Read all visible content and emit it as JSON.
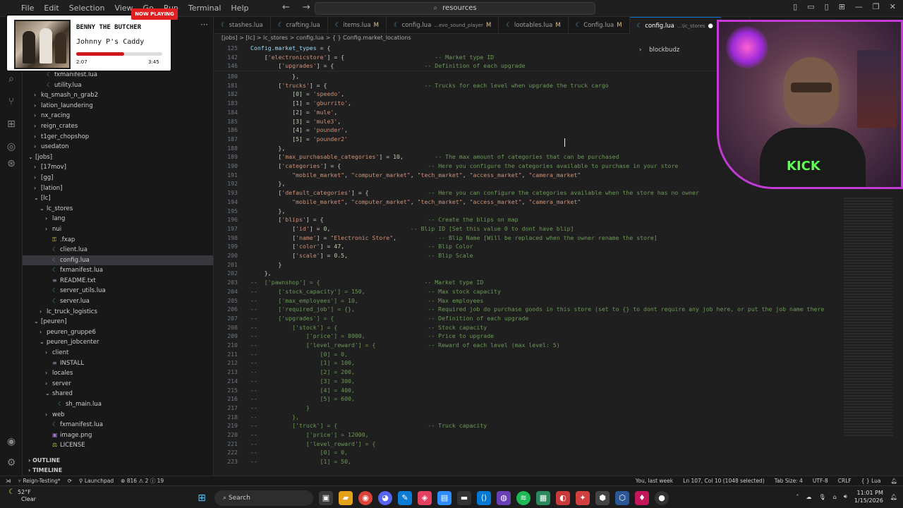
{
  "titlebar": {
    "menus": [
      "File",
      "Edit",
      "Selection",
      "View",
      "Go",
      "Run",
      "Terminal",
      "Help"
    ],
    "search_text": "resources"
  },
  "now_playing": {
    "badge": "NOW PLAYING",
    "artist": "BENNY THE BUTCHER",
    "song": "Johnny P's Caddy",
    "elapsed": "2:07",
    "duration": "3:45",
    "progress": 0.56
  },
  "explorer": {
    "rows": [
      {
        "label": "fxmanifest.lua",
        "depth": 2,
        "kind": "file",
        "icon": "lua",
        "badge": ""
      },
      {
        "label": "utility.lua",
        "depth": 2,
        "kind": "file",
        "icon": "lua",
        "badge": ""
      },
      {
        "label": "kq_smash_n_grab2",
        "depth": 1,
        "kind": "folder",
        "icon": "",
        "badge": ""
      },
      {
        "label": "lation_laundering",
        "depth": 1,
        "kind": "folder",
        "icon": "",
        "badge": ""
      },
      {
        "label": "nx_racing",
        "depth": 1,
        "kind": "folder",
        "icon": "",
        "badge": ""
      },
      {
        "label": "reign_crates",
        "depth": 1,
        "kind": "folder",
        "icon": "",
        "badge": ""
      },
      {
        "label": "t1ger_chopshop",
        "depth": 1,
        "kind": "folder",
        "icon": "",
        "badge": ""
      },
      {
        "label": "usedaton",
        "depth": 1,
        "kind": "folder",
        "icon": "",
        "badge": ""
      },
      {
        "label": "[jobs]",
        "depth": 0,
        "kind": "open",
        "icon": "",
        "badge": ""
      },
      {
        "label": "[17mov]",
        "depth": 1,
        "kind": "folder",
        "icon": "",
        "badge": ""
      },
      {
        "label": "[gg]",
        "depth": 1,
        "kind": "folder",
        "icon": "",
        "badge": ""
      },
      {
        "label": "[lation]",
        "depth": 1,
        "kind": "folder",
        "icon": "",
        "badge": ""
      },
      {
        "label": "[lc]",
        "depth": 1,
        "kind": "open",
        "icon": "",
        "badge": ""
      },
      {
        "label": "lc_stores",
        "depth": 2,
        "kind": "open",
        "icon": "",
        "badge": ""
      },
      {
        "label": "lang",
        "depth": 3,
        "kind": "folder",
        "icon": "",
        "badge": ""
      },
      {
        "label": "nui",
        "depth": 3,
        "kind": "folder",
        "icon": "",
        "badge": ""
      },
      {
        "label": ".fxap",
        "depth": 3,
        "kind": "file",
        "icon": "lock",
        "badge": ""
      },
      {
        "label": "client.lua",
        "depth": 3,
        "kind": "file",
        "icon": "lua",
        "badge": ""
      },
      {
        "label": "config.lua",
        "depth": 3,
        "kind": "file",
        "icon": "lua",
        "badge": "",
        "selected": true
      },
      {
        "label": "fxmanifest.lua",
        "depth": 3,
        "kind": "file",
        "icon": "lua",
        "badge": ""
      },
      {
        "label": "README.txt",
        "depth": 3,
        "kind": "file",
        "icon": "txt",
        "badge": ""
      },
      {
        "label": "server_utils.lua",
        "depth": 3,
        "kind": "file",
        "icon": "lua",
        "badge": ""
      },
      {
        "label": "server.lua",
        "depth": 3,
        "kind": "file",
        "icon": "lua",
        "badge": ""
      },
      {
        "label": "lc_truck_logistics",
        "depth": 2,
        "kind": "folder",
        "icon": "",
        "badge": ""
      },
      {
        "label": "[peuren]",
        "depth": 1,
        "kind": "open",
        "icon": "",
        "badge": ""
      },
      {
        "label": "peuren_gruppe6",
        "depth": 2,
        "kind": "folder",
        "icon": "",
        "badge": ""
      },
      {
        "label": "peuren_jobcenter",
        "depth": 2,
        "kind": "open",
        "icon": "",
        "badge": ""
      },
      {
        "label": "client",
        "depth": 3,
        "kind": "folder",
        "icon": "",
        "badge": ""
      },
      {
        "label": "INSTALL",
        "depth": 3,
        "kind": "file",
        "icon": "txt",
        "badge": ""
      },
      {
        "label": "locales",
        "depth": 3,
        "kind": "folder",
        "icon": "",
        "badge": ""
      },
      {
        "label": "server",
        "depth": 3,
        "kind": "folder",
        "icon": "",
        "badge": ""
      },
      {
        "label": "shared",
        "depth": 3,
        "kind": "open",
        "icon": "",
        "badge": ""
      },
      {
        "label": "sh_main.lua",
        "depth": 4,
        "kind": "file",
        "icon": "lua",
        "badge": ""
      },
      {
        "label": "web",
        "depth": 3,
        "kind": "folder",
        "icon": "",
        "badge": ""
      },
      {
        "label": "fxmanifest.lua",
        "depth": 3,
        "kind": "file",
        "icon": "lua",
        "badge": ""
      },
      {
        "label": "image.png",
        "depth": 3,
        "kind": "file",
        "icon": "img",
        "badge": ""
      },
      {
        "label": "LICENSE",
        "depth": 3,
        "kind": "file",
        "icon": "lic",
        "badge": ""
      }
    ],
    "outline_label": "OUTLINE",
    "timeline_label": "TIMELINE"
  },
  "tabs": [
    {
      "label": "stashes.lua",
      "mod": "",
      "active": false
    },
    {
      "label": "crafting.lua",
      "mod": "",
      "active": false
    },
    {
      "label": "items.lua",
      "mod": "M",
      "active": false
    },
    {
      "label": "config.lua",
      "suffix": "...evo_sound_player",
      "mod": "M",
      "active": false
    },
    {
      "label": "lootables.lua",
      "mod": "M",
      "active": false
    },
    {
      "label": "Config.lua",
      "mod": "M",
      "active": false
    },
    {
      "label": "config.lua",
      "suffix": "...\\lc_stores",
      "mod": "●",
      "active": true
    },
    {
      "label": "pr",
      "mod": "",
      "active": false
    }
  ],
  "breadcrumb": "[jobs] > [lc] > lc_stores > config.lua > { } Config.market_locations",
  "find_widget": "blockbudz",
  "sticky": [
    {
      "n": "125",
      "t": "Config.market_types = {"
    },
    {
      "n": "142",
      "t": "    ['electronicstore'] = {                          -- Market type ID"
    },
    {
      "n": "146",
      "t": "        ['upgrades'] = {                          -- Definition of each upgrade"
    }
  ],
  "code": [
    {
      "n": "180",
      "t": "            },"
    },
    {
      "n": "181",
      "t": "        ['trucks'] = {                            -- Trucks for each level when upgrade the truck cargo"
    },
    {
      "n": "182",
      "t": "            [0] = 'speedo',"
    },
    {
      "n": "183",
      "t": "            [1] = 'gburrito',"
    },
    {
      "n": "184",
      "t": "            [2] = 'mule',"
    },
    {
      "n": "185",
      "t": "            [3] = 'mule3',"
    },
    {
      "n": "186",
      "t": "            [4] = 'pounder',"
    },
    {
      "n": "187",
      "t": "            [5] = 'pounder2'"
    },
    {
      "n": "188",
      "t": "        },"
    },
    {
      "n": "189",
      "t": "        ['max_purchasable_categories'] = 10,         -- The max amount of categories that can be purchased"
    },
    {
      "n": "190",
      "t": "        ['categories'] = {                         -- Here you configure the categories available to purchase in your store"
    },
    {
      "n": "191",
      "t": "            \"mobile_market\", \"computer_market\", \"tech_market\", \"access_market\", \"camera_market\""
    },
    {
      "n": "192",
      "t": "        },"
    },
    {
      "n": "193",
      "t": "        ['default_categories'] = {                 -- Here you can configure the categories available when the store has no owner"
    },
    {
      "n": "194",
      "t": "            \"mobile_market\", \"computer_market\", \"tech_market\", \"access_market\", \"camera_market\""
    },
    {
      "n": "195",
      "t": "        },"
    },
    {
      "n": "196",
      "t": "        ['blips'] = {                              -- Create the blips on map"
    },
    {
      "n": "197",
      "t": "            ['id'] = 0,                       -- Blip ID [Set this value 0 to dont have blip]"
    },
    {
      "n": "198",
      "t": "            ['name'] = \"Electronic Store\",            -- Blip Name [Will be replaced when the owner rename the store]"
    },
    {
      "n": "199",
      "t": "            ['color'] = 47,                        -- Blip Color"
    },
    {
      "n": "200",
      "t": "            ['scale'] = 0.5,                       -- Blip Scale"
    },
    {
      "n": "201",
      "t": "        }"
    },
    {
      "n": "202",
      "t": "    },"
    },
    {
      "n": "203",
      "t": "--  ['pawnshop'] = {                              -- Market type ID"
    },
    {
      "n": "204",
      "t": "--      ['stock_capacity'] = 150,                  -- Max stock capacity"
    },
    {
      "n": "205",
      "t": "--      ['max_employees'] = 10,                    -- Max employees"
    },
    {
      "n": "206",
      "t": "--      ['required_job'] = {},                     -- Required job do purchase goods in this store (set to {} to dont require any job here, or put the job name there"
    },
    {
      "n": "207",
      "t": "--      ['upgrades'] = {                           -- Definition of each upgrade"
    },
    {
      "n": "208",
      "t": "--          ['stock'] = {                          -- Stock capacity"
    },
    {
      "n": "209",
      "t": "--              ['price'] = 8000,                  -- Price to upgrade"
    },
    {
      "n": "210",
      "t": "--              ['level_reward'] = {               -- Reward of each level (max level: 5)"
    },
    {
      "n": "211",
      "t": "--                  [0] = 0,"
    },
    {
      "n": "212",
      "t": "--                  [1] = 100,"
    },
    {
      "n": "213",
      "t": "--                  [2] = 200,"
    },
    {
      "n": "214",
      "t": "--                  [3] = 300,"
    },
    {
      "n": "215",
      "t": "--                  [4] = 400,"
    },
    {
      "n": "216",
      "t": "--                  [5] = 600,"
    },
    {
      "n": "217",
      "t": "--              }"
    },
    {
      "n": "218",
      "t": "--          },"
    },
    {
      "n": "219",
      "t": "--          ['truck'] = {                          -- Truck capacity"
    },
    {
      "n": "220",
      "t": "--              ['price'] = 12000,"
    },
    {
      "n": "221",
      "t": "--              ['level_reward'] = {"
    },
    {
      "n": "222",
      "t": "--                  [0] = 0,"
    },
    {
      "n": "223",
      "t": "--                  [1] = 50,"
    }
  ],
  "webcam": {
    "shirt_text": "KICK"
  },
  "statusbar": {
    "branch": "Reign-Testing*",
    "launchpad": "Launchpad",
    "problems": "⊗ 816 ⚠ 2 ⓘ 19",
    "blame": "You, last week",
    "position": "Ln 107, Col 10 (1048 selected)",
    "tabsize": "Tab Size: 4",
    "encoding": "UTF-8",
    "eol": "CRLF",
    "language": "Lua"
  },
  "taskbar": {
    "temp": "52°F",
    "condition": "Clear",
    "search_placeholder": "Search",
    "time": "11:01 PM",
    "date": "1/15/2026"
  },
  "colors": {
    "keyword_blue": "#9cdcfe",
    "string": "#ce9178",
    "comment": "#6a9955",
    "number": "#b5cea8",
    "accent": "#0078d4"
  }
}
